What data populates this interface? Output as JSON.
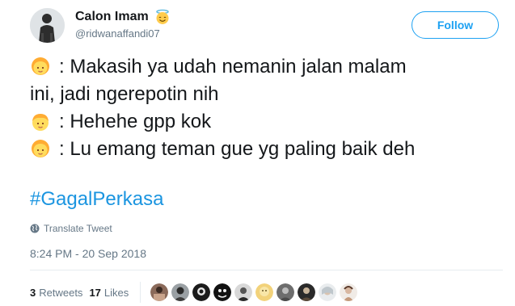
{
  "author": {
    "display_name": "Calon Imam",
    "name_emoji": "smiling-face-with-halo-icon",
    "handle": "@ridwanaffandi07"
  },
  "follow_label": "Follow",
  "tweet": {
    "lines": [
      {
        "emoji": "girl-emoji-icon",
        "text": ": Makasih ya udah nemanin jalan malam"
      },
      {
        "emoji": "",
        "text": "ini, jadi ngerepotin nih"
      },
      {
        "emoji": "boy-emoji-icon",
        "text": ": Hehehe gpp kok"
      },
      {
        "emoji": "girl-emoji-icon",
        "text": ": Lu emang teman gue yg paling baik deh"
      }
    ],
    "hashtag": "#GagalPerkasa"
  },
  "translate_label": "Translate Tweet",
  "timestamp": "8:24 PM - 20 Sep 2018",
  "stats": {
    "retweets_count": "3",
    "retweets_label": "Retweets",
    "likes_count": "17",
    "likes_label": "Likes"
  },
  "colors": {
    "accent": "#1da1f2",
    "hashtag": "#1b95e0",
    "muted": "#657786",
    "text": "#14171a"
  }
}
